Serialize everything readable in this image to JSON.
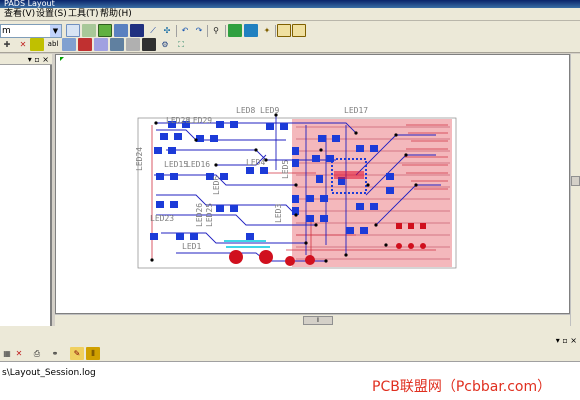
{
  "window": {
    "title": "PADS Layout"
  },
  "menu": {
    "items": [
      "查看(V)",
      "设置(S)",
      "工具(T)",
      "帮助(H)"
    ]
  },
  "toolbar": {
    "combo_value": "m"
  },
  "left_panel": {
    "controls": "▾ ▫ ×"
  },
  "board": {
    "labels": [
      "LED8",
      "LED9",
      "LED17",
      "LED24",
      "LED15",
      "LED16",
      "LED23",
      "LED6",
      "LED1",
      "LED25",
      "LED26",
      "LED28",
      "LED29",
      "LED4",
      "LED5",
      "LED3"
    ]
  },
  "bottom_panel": {
    "controls": "▾ ▫ ×"
  },
  "log": {
    "path": "s\\Layout_Session.log"
  },
  "watermark": {
    "text": "PCB联盟网（Pcbbar.com）"
  },
  "colors": {
    "trace_blue": "#2020c0",
    "pad_blue": "#1c3bd8",
    "copper_pink": "#f4b8bc",
    "pad_red": "#d0101e",
    "highlight": "#00c8e0"
  }
}
